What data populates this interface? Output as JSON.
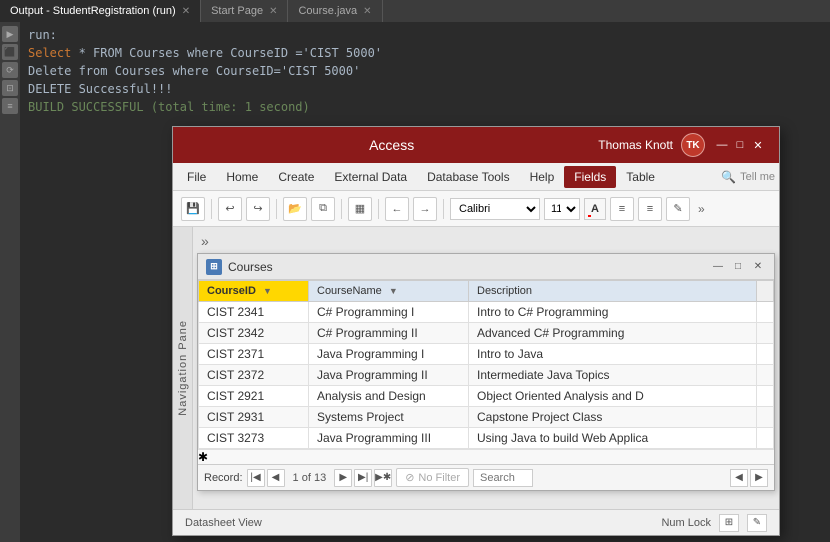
{
  "ide": {
    "tabs": [
      {
        "label": "Output - StudentRegistration (run)",
        "active": true
      },
      {
        "label": "Start Page",
        "active": false
      },
      {
        "label": "Course.java",
        "active": false
      }
    ],
    "lines": [
      {
        "text": "run:",
        "color": "white"
      },
      {
        "text": "Select * FROM Courses where CourseID ='CIST 5000'",
        "color": "white"
      },
      {
        "text": "Delete from Courses where CourseID='CIST 5000'",
        "color": "white"
      },
      {
        "text": "DELETE Successful!!!",
        "color": "white"
      },
      {
        "text": "BUILD SUCCESSFUL (total time: 1 second)",
        "color": "green"
      }
    ]
  },
  "access": {
    "title": "Access",
    "user_name": "Thomas Knott",
    "user_initials": "TK",
    "menu": {
      "items": [
        "File",
        "Home",
        "Create",
        "External Data",
        "Database Tools",
        "Help",
        "Fields",
        "Table"
      ],
      "active": "Fields",
      "search_placeholder": "Tell me"
    },
    "ribbon": {
      "font": "Calibri",
      "size": "11",
      "more": "»"
    },
    "nav_pane_label": "Navigation Pane",
    "main_more": "»",
    "courses_window": {
      "title": "Courses",
      "columns": [
        {
          "label": "CourseID",
          "is_pk": true
        },
        {
          "label": "CourseName",
          "filter": true
        },
        {
          "label": "Description",
          "filter": false
        }
      ],
      "rows": [
        {
          "id": "CIST 2341",
          "name": "C# Programming I",
          "desc": "Intro to C# Programming"
        },
        {
          "id": "CIST 2342",
          "name": "C# Programming II",
          "desc": "Advanced C# Programming"
        },
        {
          "id": "CIST 2371",
          "name": "Java Programming I",
          "desc": "Intro to Java"
        },
        {
          "id": "CIST 2372",
          "name": "Java Programming II",
          "desc": "Intermediate Java Topics"
        },
        {
          "id": "CIST 2921",
          "name": "Analysis and Design",
          "desc": "Object Oriented Analysis and D"
        },
        {
          "id": "CIST 2931",
          "name": "Systems Project",
          "desc": "Capstone Project Class"
        },
        {
          "id": "CIST 3273",
          "name": "Java Programming III",
          "desc": "Using Java to build Web Applica"
        }
      ],
      "record_current": "1",
      "record_total": "13",
      "filter_label": "No Filter",
      "search_placeholder": "Search"
    },
    "status_bar": {
      "left": "Datasheet View",
      "right": "Num Lock"
    }
  }
}
